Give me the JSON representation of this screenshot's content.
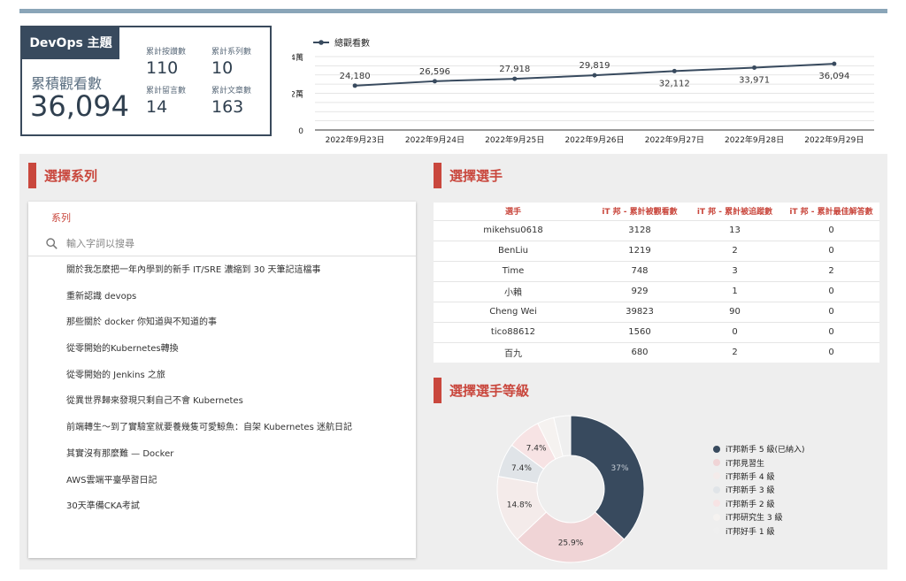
{
  "summary": {
    "tag": "DevOps 主題",
    "views_label": "累積觀看數",
    "views_value": "36,094",
    "stats": [
      {
        "label": "累計按讚數",
        "value": "110"
      },
      {
        "label": "累計系列數",
        "value": "10"
      },
      {
        "label": "累計留言數",
        "value": "14"
      },
      {
        "label": "累計文章數",
        "value": "163"
      }
    ]
  },
  "colors": {
    "accent": "#c9473d",
    "navy": "#384a5e",
    "panel": "#eeeeee",
    "top_bar": "#8aa5b8"
  },
  "chart_data": [
    {
      "type": "line",
      "legend": "總觀看數",
      "legend_position": "top-left",
      "x": [
        "2022年9月23日",
        "2022年9月24日",
        "2022年9月25日",
        "2022年9月26日",
        "2022年9月27日",
        "2022年9月28日",
        "2022年9月29日"
      ],
      "series": [
        {
          "name": "總觀看數",
          "values": [
            24180,
            26596,
            27918,
            29819,
            32112,
            33971,
            36094
          ],
          "labels": [
            "24,180",
            "26,596",
            "27,918",
            "29,819",
            "32,112",
            "33,971",
            "36,094"
          ]
        }
      ],
      "yticks": [
        {
          "value": 0,
          "label": "0"
        },
        {
          "value": 20000,
          "label": "2萬"
        },
        {
          "value": 40000,
          "label": "4萬"
        }
      ],
      "ylim": [
        0,
        40000
      ],
      "grid": true
    },
    {
      "type": "pie",
      "title": "選擇選手等級",
      "legend_position": "right",
      "categories": [
        "iT邦新手 5 級(已納入)",
        "iT邦見習生",
        "iT邦新手 4 級",
        "iT邦新手 3 級",
        "iT邦新手 2 級",
        "iT邦研究生 3 級",
        "iT邦好手 1 級"
      ],
      "values": [
        37,
        25.9,
        14.8,
        7.4,
        7.4,
        3.7,
        3.7
      ],
      "slice_labels": [
        "37%",
        "25.9%",
        "14.8%",
        "7.4%",
        "7.4%",
        "",
        ""
      ],
      "colors": [
        "#384a5e",
        "#f0d4d6",
        "#f4ebea",
        "#e0e4e8",
        "#f7e3e4",
        "#f5f2f0",
        "#efefef"
      ]
    }
  ],
  "series_section": {
    "title": "選擇系列",
    "header": "系列",
    "search_placeholder": "輸入字詞以搜尋",
    "items": [
      "關於我怎麼把一年內學到的新手 IT/SRE 濃縮到 30 天筆記這檔事",
      "重新認識 devops",
      "那些關於 docker 你知道與不知道的事",
      "從零開始的Kubernetes轉換",
      "從零開始的 Jenkins 之旅",
      "從異世界歸來發現只剩自己不會 Kubernetes",
      "前端轉生～到了實驗室就要養幾隻可愛鯨魚：自架 Kubernetes 迷航日記",
      "其實沒有那麼難 — Docker",
      "AWS雲端平臺學習日記",
      "30天準備CKA考試"
    ]
  },
  "players_section": {
    "title": "選擇選手",
    "columns": [
      "選手",
      "iT 邦 - 累計被觀看數",
      "iT 邦 - 累計被追蹤數",
      "iT 邦 - 累計最佳解答數"
    ],
    "rows": [
      [
        "mikehsu0618",
        "3128",
        "13",
        "0"
      ],
      [
        "BenLiu",
        "1219",
        "2",
        "0"
      ],
      [
        "Time",
        "748",
        "3",
        "2"
      ],
      [
        "小賴",
        "929",
        "1",
        "0"
      ],
      [
        "Cheng Wei",
        "39823",
        "90",
        "0"
      ],
      [
        "tico88612",
        "1560",
        "0",
        "0"
      ],
      [
        "百九",
        "680",
        "2",
        "0"
      ]
    ]
  },
  "level_section": {
    "title": "選擇選手等級"
  }
}
